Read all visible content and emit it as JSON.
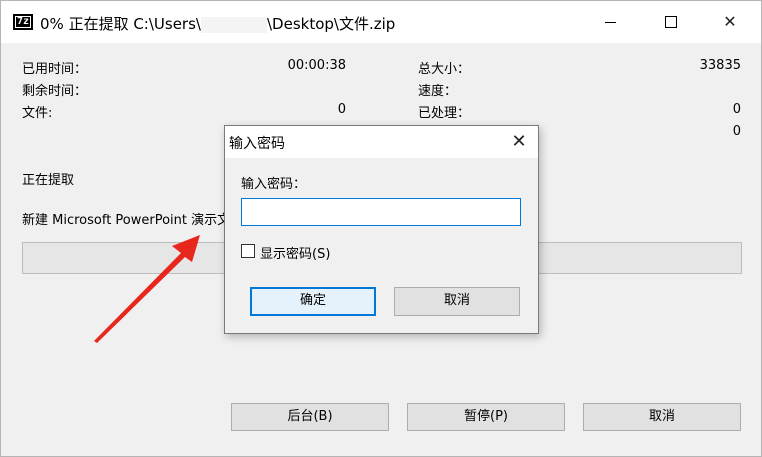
{
  "window": {
    "app_icon_text": "7z",
    "title_prefix": "0% 正在提取 C:\\Users\\",
    "title_suffix": "\\Desktop\\文件.zip",
    "controls": {
      "minimize": "",
      "maximize": "",
      "close": "✕"
    }
  },
  "stats": {
    "elapsed_label": "已用时间：",
    "elapsed_value": "00:00:38",
    "remaining_label": "剩余时间：",
    "files_label": "文件:",
    "files_value": "0",
    "total_label": "总大小：",
    "total_value": "33835",
    "speed_label": "速度：",
    "processed_label": "已处理：",
    "processed_value": "0",
    "extra_value": "0"
  },
  "status": {
    "extracting_label": "正在提取",
    "current_file": "新建 Microsoft PowerPoint 演示文"
  },
  "buttons": {
    "background": "后台(B)",
    "pause": "暂停(P)",
    "cancel": "取消"
  },
  "dialog": {
    "title": "输入密码",
    "close": "✕",
    "field_label": "输入密码：",
    "password_value": "",
    "show_password_label": "显示密码(S)",
    "show_password_checked": false,
    "ok": "确定",
    "cancel": "取消"
  },
  "colors": {
    "accent": "#0078d7",
    "arrow": "#e8271c",
    "window_bg": "#f0f0f0"
  }
}
